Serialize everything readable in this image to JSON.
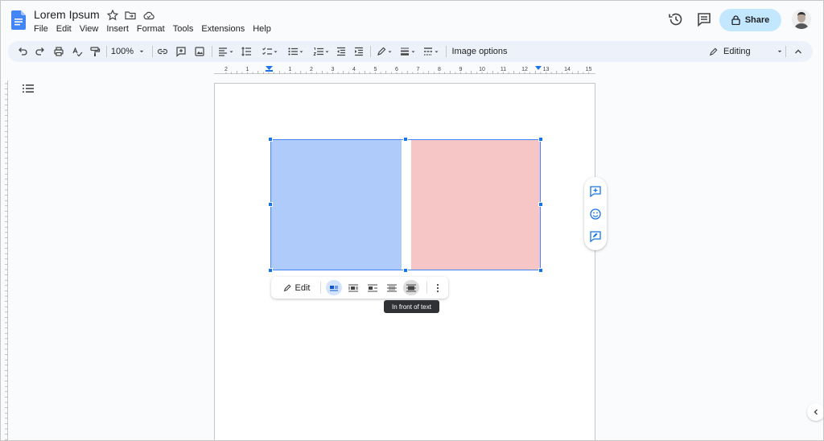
{
  "document": {
    "title": "Lorem Ipsum"
  },
  "menu": [
    "File",
    "Edit",
    "View",
    "Insert",
    "Format",
    "Tools",
    "Extensions",
    "Help"
  ],
  "header": {
    "share_label": "Share"
  },
  "toolbar": {
    "zoom": "100%",
    "image_options": "Image options",
    "mode": "Editing"
  },
  "ruler": {
    "labels": [
      "2",
      "1",
      "1",
      "2",
      "3",
      "4",
      "5",
      "6",
      "7",
      "8",
      "9",
      "10",
      "11",
      "12",
      "13",
      "14",
      "15"
    ]
  },
  "image_toolbar": {
    "edit_label": "Edit",
    "wrap_options": [
      "inline",
      "wrap-text",
      "break-text",
      "behind-text",
      "in-front-of-text"
    ],
    "selected": "inline"
  },
  "tooltip": {
    "text": "In front of text"
  },
  "image": {
    "left_color": "#aecbfa",
    "right_color": "#f6c6c6"
  },
  "colors": {
    "accent": "#1a73e8",
    "share_bg": "#c2e7ff",
    "toolbar_bg": "#edf2fa"
  }
}
